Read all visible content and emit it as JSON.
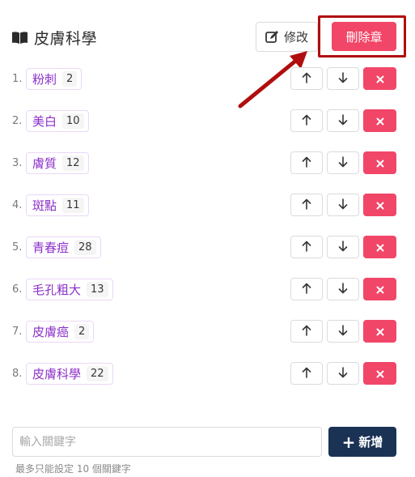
{
  "header": {
    "title": "皮膚科學",
    "edit_label": "修改",
    "delete_chapter_label": "刪除章"
  },
  "items": [
    {
      "index": "1.",
      "label": "粉刺",
      "count": "2"
    },
    {
      "index": "2.",
      "label": "美白",
      "count": "10"
    },
    {
      "index": "3.",
      "label": "膚質",
      "count": "12"
    },
    {
      "index": "4.",
      "label": "斑點",
      "count": "11"
    },
    {
      "index": "5.",
      "label": "青春痘",
      "count": "28"
    },
    {
      "index": "6.",
      "label": "毛孔粗大",
      "count": "13"
    },
    {
      "index": "7.",
      "label": "皮膚癌",
      "count": "2"
    },
    {
      "index": "8.",
      "label": "皮膚科學",
      "count": "22"
    }
  ],
  "footer": {
    "input_placeholder": "輸入關鍵字",
    "input_value": "",
    "add_label": "新增",
    "help_text": "最多只能設定 10 個關鍵字"
  },
  "icons": {
    "title": "book-open-icon",
    "edit": "edit-icon",
    "up": "arrow-up-icon",
    "down": "arrow-down-icon",
    "delete": "close-icon",
    "add": "plus-icon"
  },
  "colors": {
    "accent": "#8c2fc9",
    "danger": "#f14668",
    "primary_dark": "#1a3254",
    "annotation_red": "#b00e0e"
  }
}
